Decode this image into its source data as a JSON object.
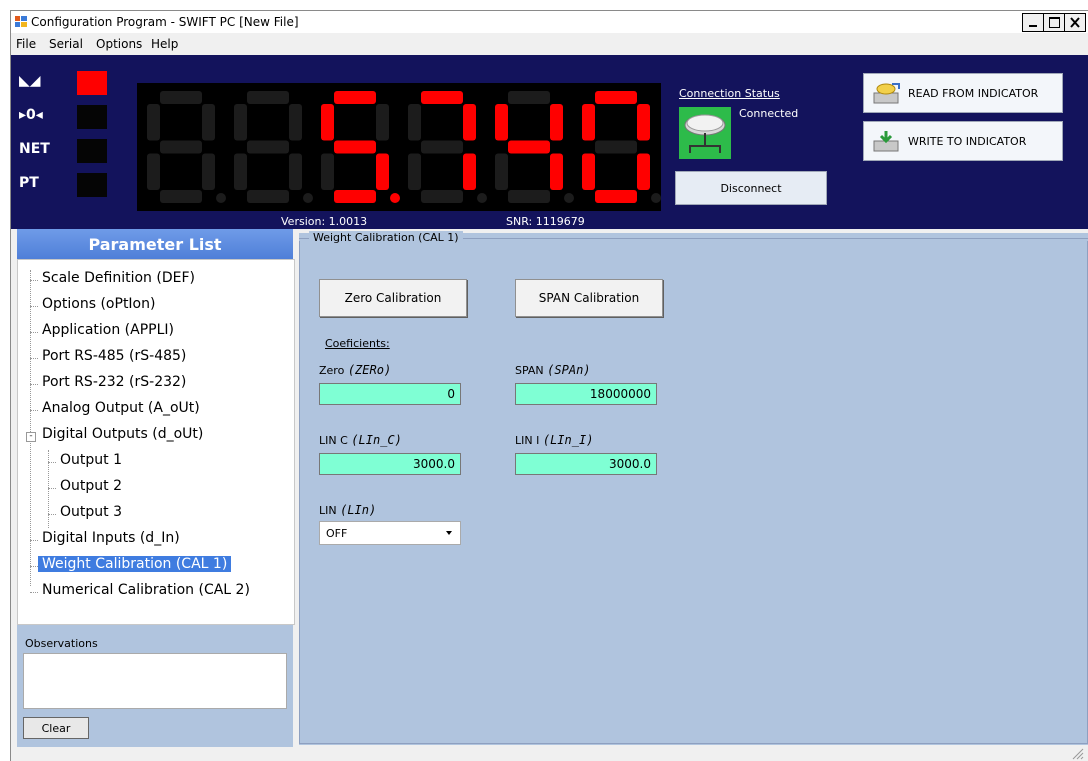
{
  "window": {
    "title": "Configuration Program - SWIFT PC  [New File]"
  },
  "menu": [
    "File",
    "Serial",
    "Options",
    "Help"
  ],
  "indicators": [
    {
      "label": "◣◢",
      "active": true,
      "color": "#ff0000"
    },
    {
      "label": "▸0◂",
      "active": false
    },
    {
      "label": "NET",
      "active": false
    },
    {
      "label": "PT",
      "active": false
    }
  ],
  "display": {
    "value": "5740",
    "digit_count": 6,
    "lit_color": "#ff0000",
    "dim_color": "#1c1c1c"
  },
  "device": {
    "version": "Version: 1.0013",
    "snr": "SNR: 1119679"
  },
  "connection": {
    "label": "Connection Status",
    "status": "Connected",
    "disconnect": "Disconnect"
  },
  "actions": {
    "read": "READ FROM INDICATOR",
    "write": "WRITE TO INDICATOR"
  },
  "parameter_list": {
    "title": "Parameter List",
    "items": [
      "Scale Definition (DEF)",
      "Options (oPtIon)",
      "Application (APPLI)",
      "Port RS-485 (rS-485)",
      "Port RS-232 (rS-232)",
      "Analog Output (A_oUt)",
      "Digital Outputs (d_oUt)",
      "Output 1",
      "Output 2",
      "Output 3",
      "Digital Inputs (d_In)",
      "Weight Calibration (CAL 1)",
      "Numerical Calibration (CAL 2)"
    ],
    "selected": "Weight Calibration (CAL 1)"
  },
  "observations": {
    "label": "Observations",
    "text": "",
    "clear": "Clear"
  },
  "calibration": {
    "group_title": "Weight Calibration (CAL 1)",
    "zero_btn": "Zero Calibration",
    "span_btn": "SPAN Calibration",
    "coef_label": "Coeficients:",
    "zero": {
      "label": "Zero",
      "code": "(ZERo)",
      "value": "0"
    },
    "span": {
      "label": "SPAN",
      "code": "(SPAn)",
      "value": "18000000"
    },
    "lin_c": {
      "label": "LIN C",
      "code": "(LIn_C)",
      "value": "3000.0"
    },
    "lin_i": {
      "label": "LIN I",
      "code": "(LIn_I)",
      "value": "3000.0"
    },
    "lin": {
      "label": "LIN",
      "code": "(LIn)",
      "value": "OFF"
    }
  }
}
